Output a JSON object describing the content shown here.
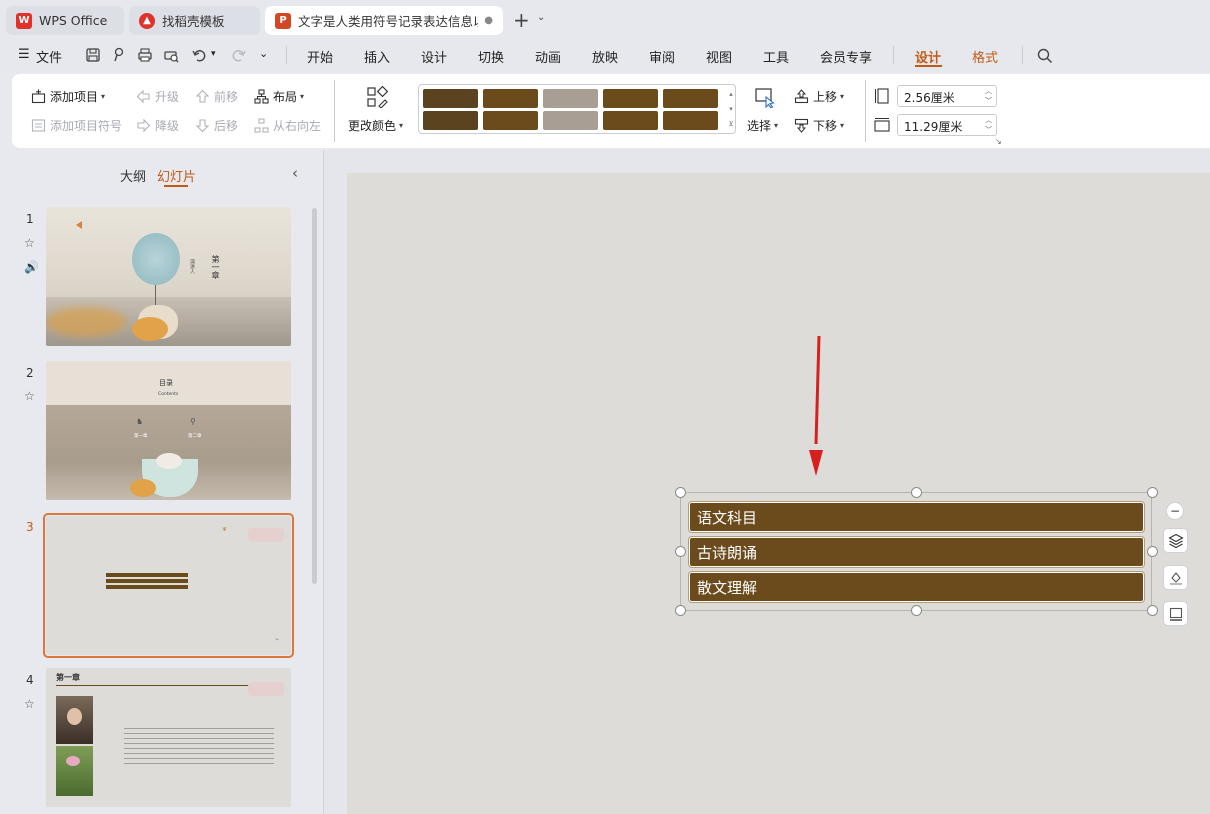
{
  "tabs": [
    {
      "label": "WPS Office",
      "icon": "wps-logo-icon",
      "color": "#e0312b"
    },
    {
      "label": "找稻壳模板",
      "icon": "docer-logo-icon",
      "color": "#e0312b"
    },
    {
      "label": "文字是人类用符号记录表达信息以",
      "icon": "presentation-file-icon",
      "color": "#d24726",
      "modified_dot": "●"
    }
  ],
  "menu": {
    "file": "文件",
    "items": [
      "开始",
      "插入",
      "设计",
      "切换",
      "动画",
      "放映",
      "审阅",
      "视图",
      "工具",
      "会员专享"
    ],
    "context_tabs": [
      "设计",
      "格式"
    ]
  },
  "ribbon": {
    "add_item": "添加项目",
    "add_bullet": "添加项目符号",
    "promote": "升级",
    "demote": "降级",
    "move_forward": "前移",
    "move_backward": "后移",
    "layout": "布局",
    "right_to_left": "从右向左",
    "change_color": "更改颜色",
    "select": "选择",
    "move_up": "上移",
    "move_down": "下移",
    "height_value": "2.56厘米",
    "width_value": "11.29厘米"
  },
  "swatches": [
    "#5b4320",
    "#6b4a1c",
    "#a89e93",
    "#6b4a1c",
    "#6b4a1c"
  ],
  "left_panel": {
    "outline_tab": "大纲",
    "slides_tab": "幻灯片",
    "slide_numbers": [
      "1",
      "2",
      "3",
      "4"
    ]
  },
  "thumbs": {
    "s1_title": "第一章",
    "s1_sub": "演讲人",
    "s2_title": "目录",
    "s2_sub": "Contents",
    "s2_item1": "第一章",
    "s2_item2": "第二章",
    "s4_title": "第一章"
  },
  "smartart": {
    "items": [
      "语文科目",
      "古诗朗诵",
      "散文理解"
    ]
  }
}
